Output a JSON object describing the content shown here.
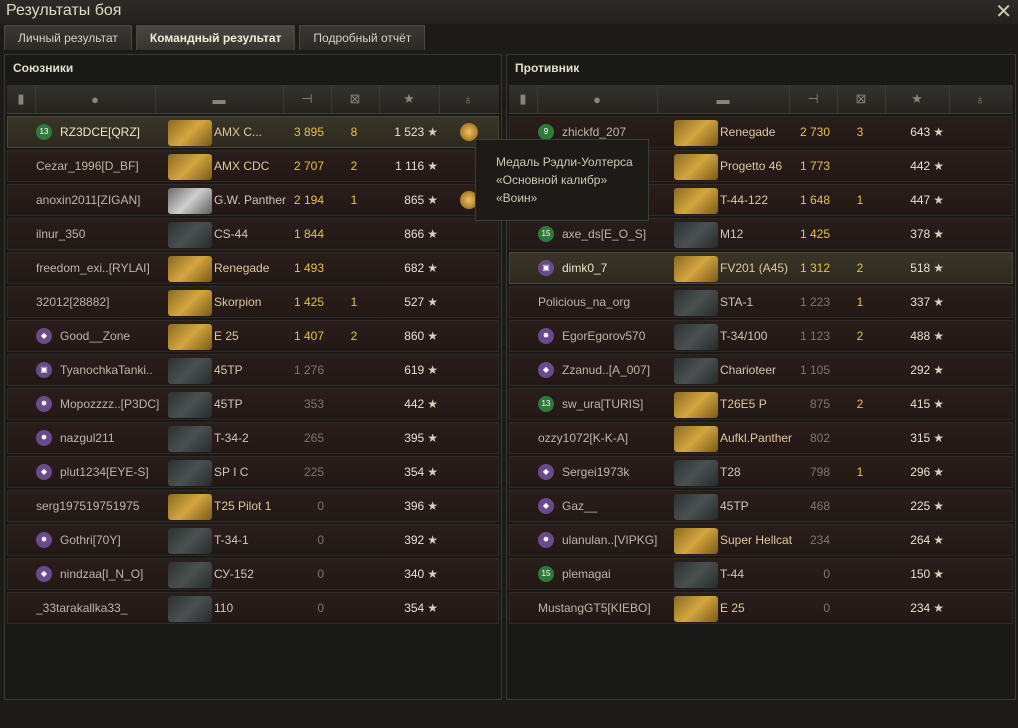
{
  "window": {
    "title": "Результаты боя",
    "close_glyph": "✕"
  },
  "tabs": [
    {
      "label": "Личный результат",
      "active": false
    },
    {
      "label": "Командный результат",
      "active": true
    },
    {
      "label": "Подробный отчёт",
      "active": false
    }
  ],
  "columns": {
    "icons": [
      "squad-icon",
      "player-icon",
      "tank-icon",
      "damage-icon",
      "kills-icon",
      "xp-star-icon",
      "medal-icon"
    ]
  },
  "allies": {
    "title": "Союзники",
    "rows": [
      {
        "player": "RZ3DCE[QRZ]",
        "tank": "AMX C...",
        "damage": "3 895",
        "kills": "8",
        "xp": "1 523",
        "badge": "13",
        "tank_style": "gold",
        "medal": true,
        "highlight": true
      },
      {
        "player": "Cezar_1996[D_BF]",
        "tank": "AMX CDC",
        "damage": "2 707",
        "kills": "2",
        "xp": "1 116",
        "badge": "",
        "tank_style": "gold",
        "medal": false,
        "highlight": false
      },
      {
        "player": "anoxin2011[ZIGAN]",
        "tank": "G.W. Panther",
        "damage": "2 194",
        "kills": "1",
        "xp": "865",
        "badge": "",
        "tank_style": "silver",
        "medal": true,
        "highlight": false
      },
      {
        "player": "ilnur_350",
        "tank": "CS-44",
        "damage": "1 844",
        "kills": "",
        "xp": "866",
        "badge": "",
        "tank_style": "dark",
        "medal": false,
        "highlight": false
      },
      {
        "player": "freedom_exi..[RYLAI]",
        "tank": "Renegade",
        "damage": "1 493",
        "kills": "",
        "xp": "682",
        "badge": "",
        "tank_style": "gold",
        "medal": false,
        "highlight": false
      },
      {
        "player": "32012[28882]",
        "tank": "Skorpion",
        "damage": "1 425",
        "kills": "1",
        "xp": "527",
        "badge": "",
        "tank_style": "gold",
        "medal": false,
        "highlight": false
      },
      {
        "player": "Good__Zone",
        "tank": "E 25",
        "damage": "1 407",
        "kills": "2",
        "xp": "860",
        "badge": "◆",
        "tank_style": "gold",
        "medal": false,
        "highlight": false
      },
      {
        "player": "TyanochkaTanki..",
        "tank": "45TP",
        "damage": "1 276",
        "kills": "",
        "xp": "619",
        "badge": "▣",
        "tank_style": "dark",
        "medal": false,
        "highlight": false
      },
      {
        "player": "Mopozzzz..[P3DC]",
        "tank": "45TP",
        "damage": "353",
        "kills": "",
        "xp": "442",
        "badge": "✸",
        "tank_style": "dark",
        "medal": false,
        "highlight": false
      },
      {
        "player": "nazgul211",
        "tank": "T-34-2",
        "damage": "265",
        "kills": "",
        "xp": "395",
        "badge": "✸",
        "tank_style": "dark",
        "medal": false,
        "highlight": false
      },
      {
        "player": "plut1234[EYE-S]",
        "tank": "SP I C",
        "damage": "225",
        "kills": "",
        "xp": "354",
        "badge": "◆",
        "tank_style": "dark",
        "medal": false,
        "highlight": false
      },
      {
        "player": "serg197519751975",
        "tank": "T25 Pilot 1",
        "damage": "0",
        "kills": "",
        "xp": "396",
        "badge": "",
        "tank_style": "gold",
        "medal": false,
        "highlight": false
      },
      {
        "player": "Gothri[70Y]",
        "tank": "T-34-1",
        "damage": "0",
        "kills": "",
        "xp": "392",
        "badge": "✸",
        "tank_style": "dark",
        "medal": false,
        "highlight": false
      },
      {
        "player": "nindzaa[I_N_O]",
        "tank": "СУ-152",
        "damage": "0",
        "kills": "",
        "xp": "340",
        "badge": "◆",
        "tank_style": "dark",
        "medal": false,
        "highlight": false
      },
      {
        "player": "_33tarakallka33_",
        "tank": "110",
        "damage": "0",
        "kills": "",
        "xp": "354",
        "badge": "",
        "tank_style": "dark",
        "medal": false,
        "highlight": false
      }
    ]
  },
  "enemies": {
    "title": "Противник",
    "rows": [
      {
        "player": "zhickfd_207",
        "tank": "Renegade",
        "damage": "2 730",
        "kills": "3",
        "xp": "643",
        "badge": "9",
        "tank_style": "gold",
        "highlight": false
      },
      {
        "player": "",
        "tank": "Progetto 46",
        "damage": "1 773",
        "kills": "",
        "xp": "442",
        "badge": "",
        "tank_style": "gold",
        "highlight": false
      },
      {
        "player": "",
        "tank": "T-44-122",
        "damage": "1 648",
        "kills": "1",
        "xp": "447",
        "badge": "",
        "tank_style": "gold",
        "highlight": false
      },
      {
        "player": "axe_ds[E_O_S]",
        "tank": "M12",
        "damage": "1 425",
        "kills": "",
        "xp": "378",
        "badge": "15",
        "tank_style": "dark",
        "highlight": false
      },
      {
        "player": "dimk0_7",
        "tank": "FV201 (A45)",
        "damage": "1 312",
        "kills": "2",
        "xp": "518",
        "badge": "▣",
        "tank_style": "gold",
        "highlight": true
      },
      {
        "player": "Policious_na_org",
        "tank": "STA-1",
        "damage": "1 223",
        "kills": "1",
        "xp": "337",
        "badge": "",
        "tank_style": "dark",
        "highlight": false
      },
      {
        "player": "EgorEgorov570",
        "tank": "T-34/100",
        "damage": "1 123",
        "kills": "2",
        "xp": "488",
        "badge": "✸",
        "tank_style": "dark",
        "highlight": false
      },
      {
        "player": "Zzanud..[A_007]",
        "tank": "Charioteer",
        "damage": "1 105",
        "kills": "",
        "xp": "292",
        "badge": "◆",
        "tank_style": "dark",
        "highlight": false
      },
      {
        "player": "sw_ura[TURIS]",
        "tank": "T26E5 P",
        "damage": "875",
        "kills": "2",
        "xp": "415",
        "badge": "13",
        "tank_style": "gold",
        "highlight": false
      },
      {
        "player": "ozzy1072[K-K-A]",
        "tank": "Aufkl.Panther",
        "damage": "802",
        "kills": "",
        "xp": "315",
        "badge": "",
        "tank_style": "gold",
        "highlight": false
      },
      {
        "player": "Sergei1973k",
        "tank": "T28",
        "damage": "798",
        "kills": "1",
        "xp": "296",
        "badge": "◆",
        "tank_style": "dark",
        "highlight": false
      },
      {
        "player": "Gaz__",
        "tank": "45TP",
        "damage": "468",
        "kills": "",
        "xp": "225",
        "badge": "◆",
        "tank_style": "dark",
        "highlight": false
      },
      {
        "player": "ulanulan..[VIPKG]",
        "tank": "Super Hellcat",
        "damage": "234",
        "kills": "",
        "xp": "264",
        "badge": "✸",
        "tank_style": "gold",
        "highlight": false
      },
      {
        "player": "plemagai",
        "tank": "T-44",
        "damage": "0",
        "kills": "",
        "xp": "150",
        "badge": "15",
        "tank_style": "dark",
        "highlight": false
      },
      {
        "player": "MustangGT5[KIEBO]",
        "tank": "E 25",
        "damage": "0",
        "kills": "",
        "xp": "234",
        "badge": "",
        "tank_style": "gold",
        "highlight": false
      }
    ]
  },
  "tooltip": {
    "lines": [
      "Медаль Рэдли-Уолтерса",
      "«Основной калибр»",
      "«Воин»"
    ]
  },
  "star_glyph": "★"
}
